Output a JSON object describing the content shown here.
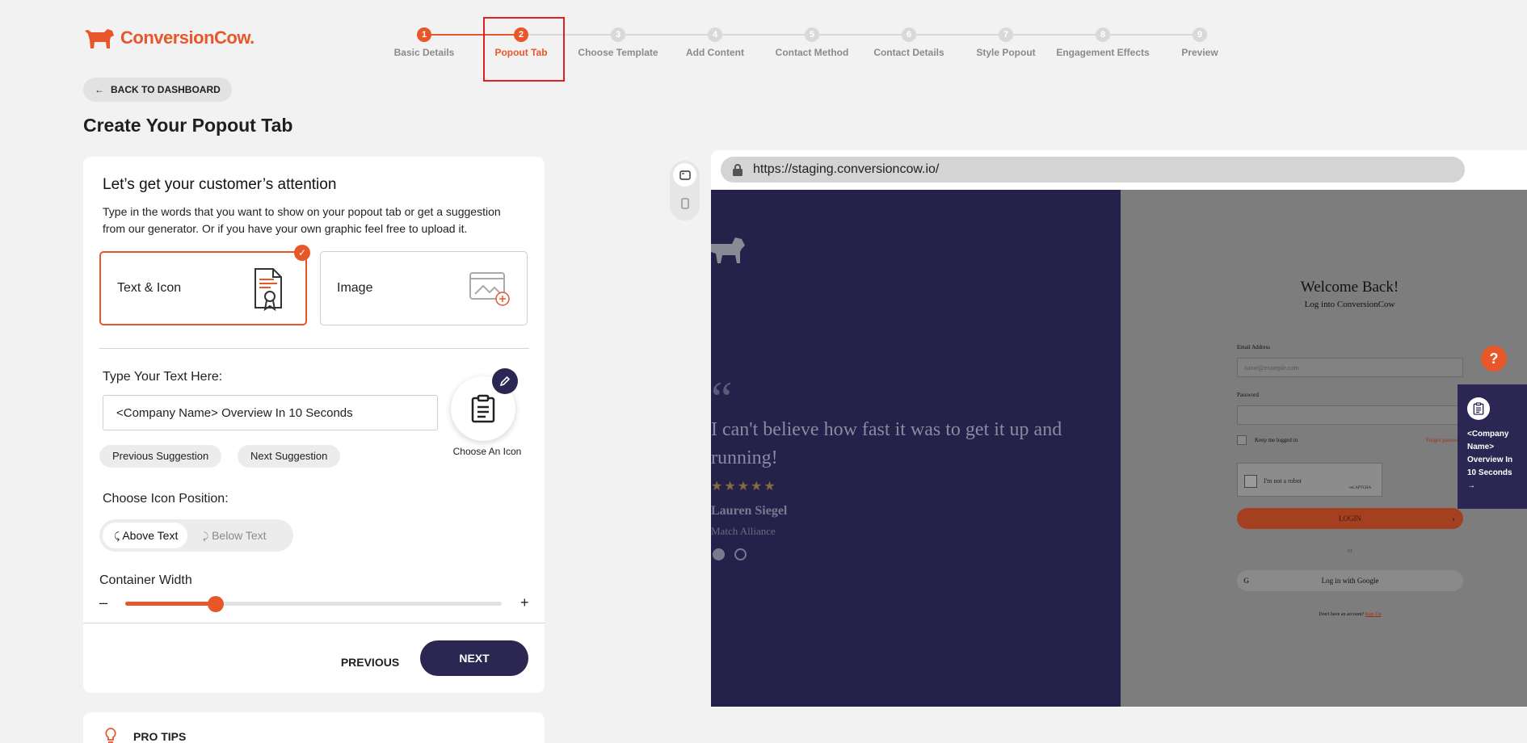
{
  "brand": {
    "name": "ConversionCow.",
    "accent": "#e8572a",
    "dark": "#2b2752"
  },
  "stepper": {
    "active_index": 1,
    "steps": [
      {
        "num": "1",
        "label": "Basic Details",
        "state": "done"
      },
      {
        "num": "2",
        "label": "Popout Tab",
        "state": "active"
      },
      {
        "num": "3",
        "label": "Choose Template",
        "state": "todo"
      },
      {
        "num": "4",
        "label": "Add Content",
        "state": "todo"
      },
      {
        "num": "5",
        "label": "Contact Method",
        "state": "todo"
      },
      {
        "num": "6",
        "label": "Contact Details",
        "state": "todo"
      },
      {
        "num": "7",
        "label": "Style Popout",
        "state": "todo"
      },
      {
        "num": "8",
        "label": "Engagement Effects",
        "state": "todo"
      },
      {
        "num": "9",
        "label": "Preview",
        "state": "todo"
      }
    ]
  },
  "back_label": "BACK TO DASHBOARD",
  "page_title": "Create Your Popout Tab",
  "form": {
    "heading": "Let’s get your customer’s attention",
    "description": "Type in the words that you want to show on your popout tab or get a suggestion from our generator. Or if you have your own graphic feel free to upload it.",
    "option_text_icon": "Text & Icon",
    "option_image": "Image",
    "selected_option": "Text & Icon",
    "text_label": "Type Your Text Here:",
    "text_value": "<Company Name> Overview In 10 Seconds",
    "prev_suggestion": "Previous Suggestion",
    "next_suggestion": "Next Suggestion",
    "choose_icon": "Choose An Icon",
    "icon_position_label": "Choose Icon Position:",
    "pos_above": "Above Text",
    "pos_below": "Below Text",
    "selected_position": "Above Text",
    "width_label": "Container Width",
    "width_fraction": 0.24,
    "minus": "–",
    "plus": "+",
    "previous": "PREVIOUS",
    "next": "NEXT"
  },
  "pro_tips": "PRO TIPS",
  "preview": {
    "url": "https://staging.conversioncow.io/",
    "quote_mark": "“",
    "quote": "I can't believe how fast it was to get it up and running!",
    "stars": "★★★★★",
    "quote_name": "Lauren Siegel",
    "quote_company": "Match Alliance",
    "welcome": "Welcome Back!",
    "login_sub": "Log into ConversionCow",
    "email_label": "Email Address",
    "email_placeholder": "name@example.com",
    "password_label": "Password",
    "keep_logged": "Keep me logged in",
    "forgot": "Forgot password?",
    "robot": "I'm not a robot",
    "recaptcha": "reCAPTCHA",
    "login_btn": "LOGIN",
    "or": "or",
    "google": "Log in with Google",
    "no_account": "Don't have an account?",
    "signup": "Sign Up",
    "help": "?",
    "popout_text": "<Company Name> Overview In 10 Seconds →"
  }
}
